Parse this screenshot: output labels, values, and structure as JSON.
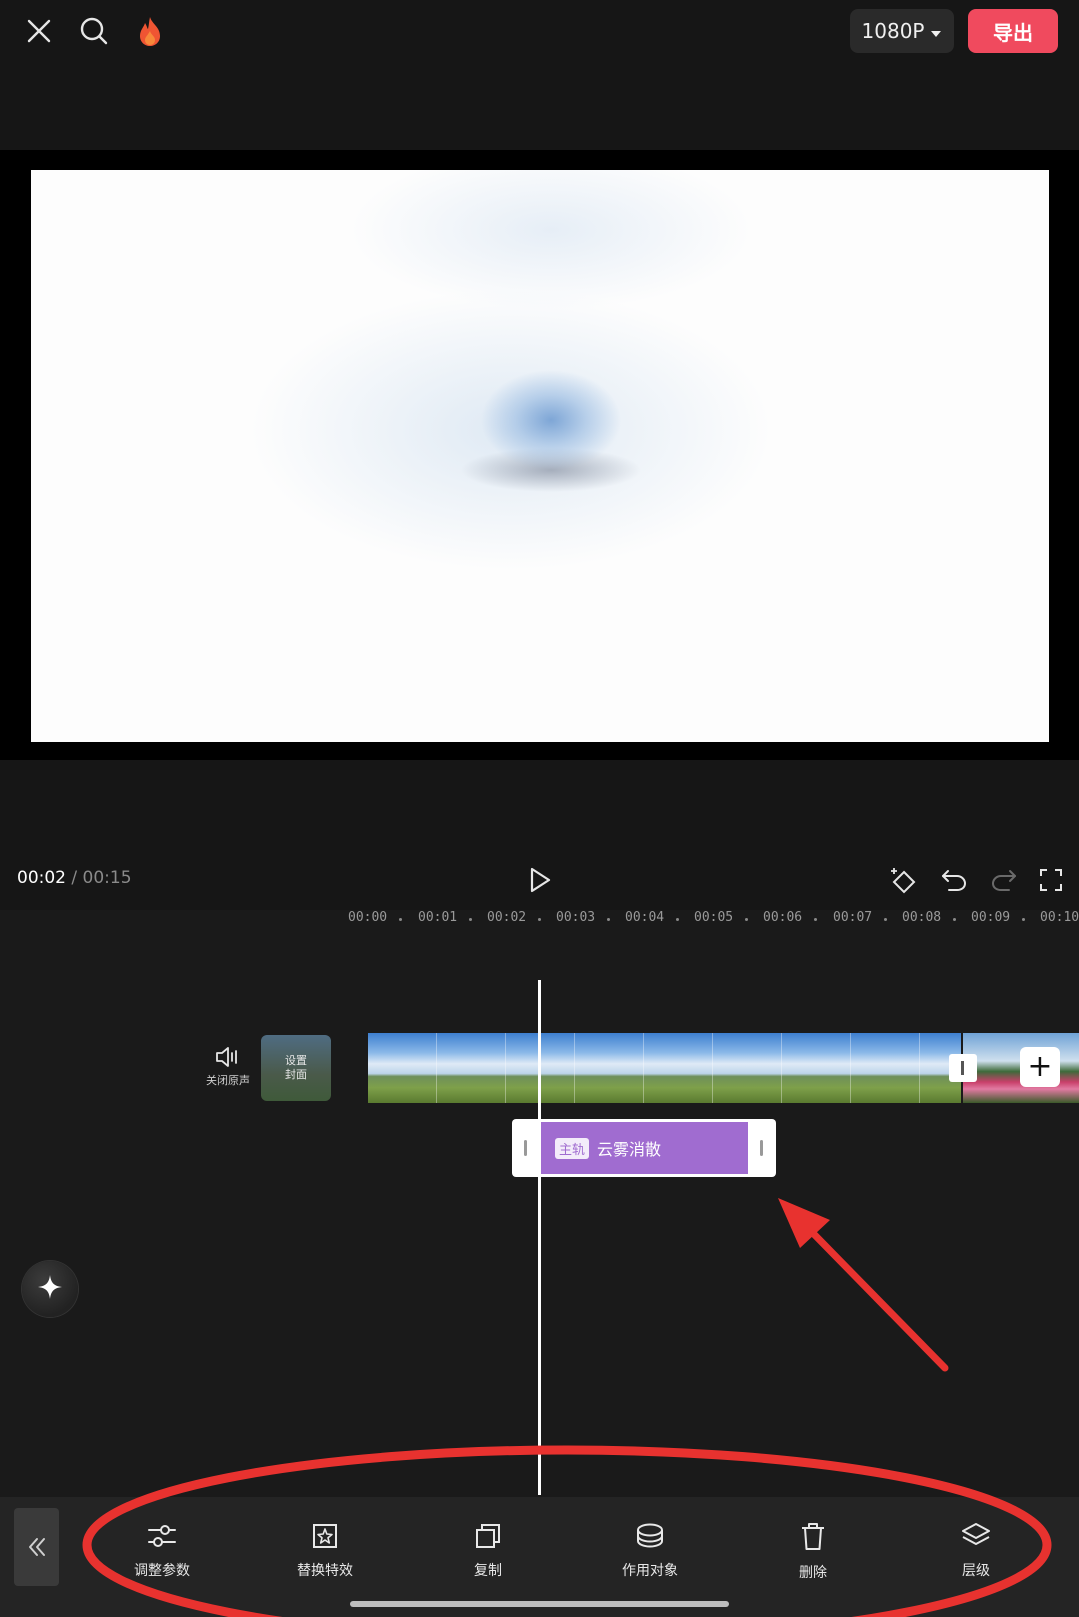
{
  "topbar": {
    "resolution_label": "1080P",
    "export_label": "导出"
  },
  "playback": {
    "current_time": "00:02",
    "separator": " / ",
    "total_time": "00:15"
  },
  "ruler": {
    "ticks": [
      "00:00",
      "00:01",
      "00:02",
      "00:03",
      "00:04",
      "00:05",
      "00:06",
      "00:07",
      "00:08",
      "00:09",
      "00:10"
    ]
  },
  "tracks": {
    "mute_label": "关闭原声",
    "cover_label_line1": "设置",
    "cover_label_line2": "封面",
    "add_clip_symbol": "+",
    "effect": {
      "tag": "主轨",
      "name": "云雾消散"
    }
  },
  "toolbar": {
    "items": [
      {
        "label": "调整参数",
        "icon": "sliders-icon"
      },
      {
        "label": "替换特效",
        "icon": "replace-effect-icon"
      },
      {
        "label": "复制",
        "icon": "copy-icon"
      },
      {
        "label": "作用对象",
        "icon": "target-object-icon"
      },
      {
        "label": "删除",
        "icon": "trash-icon"
      },
      {
        "label": "层级",
        "icon": "layers-icon"
      }
    ]
  },
  "colors": {
    "accent_export": "#f04a5e",
    "effect_clip": "#a06cd0",
    "annotation": "#e8322f"
  }
}
